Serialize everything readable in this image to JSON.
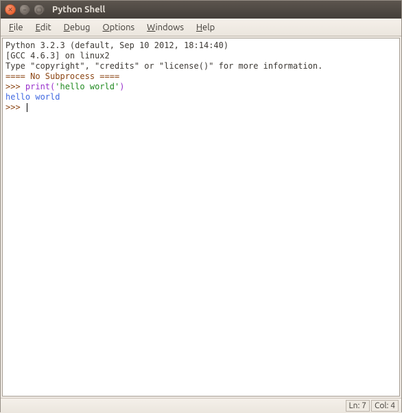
{
  "window": {
    "title": "Python Shell"
  },
  "menu": {
    "file": "File",
    "edit": "Edit",
    "debug": "Debug",
    "options": "Options",
    "windows": "Windows",
    "help": "Help"
  },
  "console": {
    "version_line": "Python 3.2.3 (default, Sep 10 2012, 18:14:40)",
    "gcc_line": "[GCC 4.6.3] on linux2",
    "info_line": "Type \"copyright\", \"credits\" or \"license()\" for more information.",
    "subprocess_line": "==== No Subprocess ====",
    "prompt1": ">>> ",
    "input_func": "print",
    "input_paren_open": "(",
    "input_string": "'hello world'",
    "input_paren_close": ")",
    "output_line": "hello world",
    "prompt2": ">>> "
  },
  "status": {
    "line": "Ln: 7",
    "col": "Col: 4"
  }
}
